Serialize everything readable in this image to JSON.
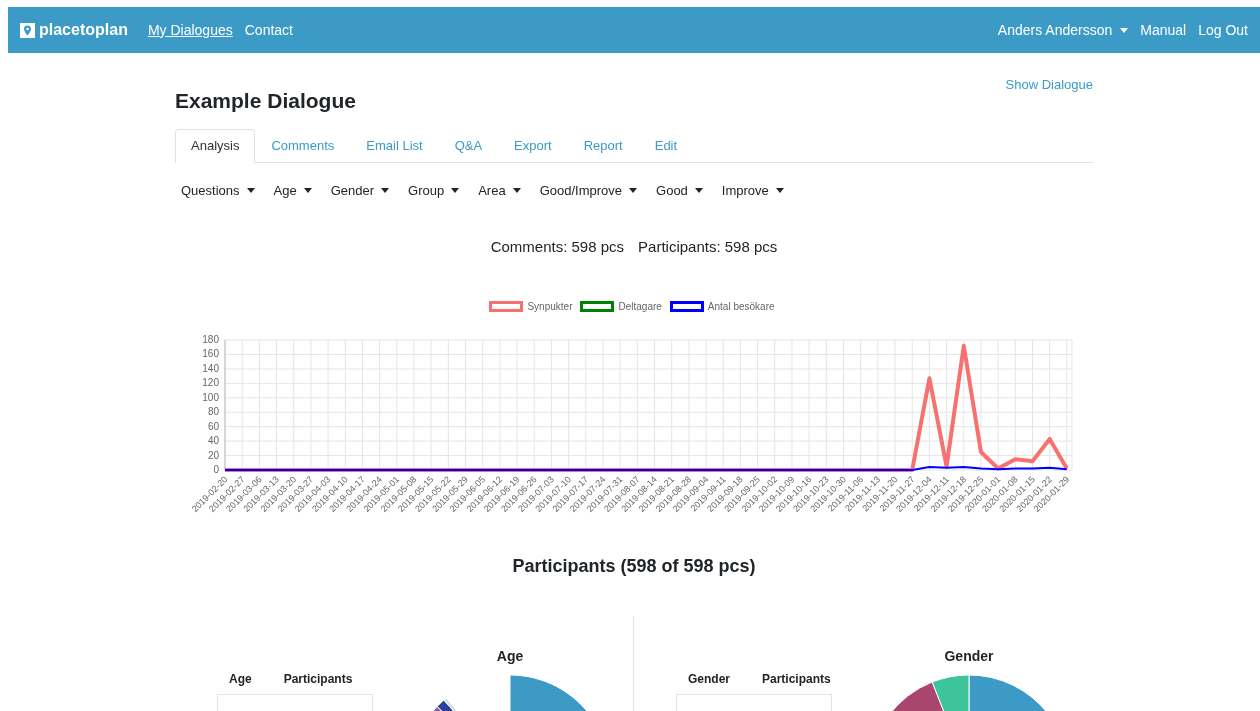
{
  "navbar": {
    "brand": "placetoplan",
    "links": [
      {
        "label": "My Dialogues",
        "selected": true
      },
      {
        "label": "Contact",
        "selected": false
      }
    ],
    "user": "Anders Andersson",
    "right_links": [
      "Manual",
      "Log Out"
    ]
  },
  "page": {
    "title": "Example Dialogue",
    "show_link": "Show Dialogue"
  },
  "tabs": [
    {
      "label": "Analysis",
      "selected": true
    },
    {
      "label": "Comments",
      "selected": false
    },
    {
      "label": "Email List",
      "selected": false
    },
    {
      "label": "Q&A",
      "selected": false
    },
    {
      "label": "Export",
      "selected": false
    },
    {
      "label": "Report",
      "selected": false
    },
    {
      "label": "Edit",
      "selected": false
    }
  ],
  "filters": [
    "Questions",
    "Age",
    "Gender",
    "Group",
    "Area",
    "Good/Improve",
    "Good",
    "Improve"
  ],
  "stats": [
    "Comments: 598 pcs",
    "Participants: 598 pcs"
  ],
  "chart": {
    "chart_data": {
      "type": "line",
      "categories": [
        "2019-02-20",
        "2019-02-27",
        "2019-03-06",
        "2019-03-13",
        "2019-03-20",
        "2019-03-27",
        "2019-04-03",
        "2019-04-10",
        "2019-04-17",
        "2019-04-24",
        "2019-05-01",
        "2019-05-08",
        "2019-05-15",
        "2019-05-22",
        "2019-05-29",
        "2019-06-05",
        "2019-06-12",
        "2019-06-19",
        "2019-06-26",
        "2019-07-03",
        "2019-07-10",
        "2019-07-17",
        "2019-07-24",
        "2019-07-31",
        "2019-08-07",
        "2019-08-14",
        "2019-08-21",
        "2019-08-28",
        "2019-09-04",
        "2019-09-11",
        "2019-09-18",
        "2019-09-25",
        "2019-10-02",
        "2019-10-09",
        "2019-10-16",
        "2019-10-23",
        "2019-10-30",
        "2019-11-06",
        "2019-11-13",
        "2019-11-20",
        "2019-11-27",
        "2019-12-04",
        "2019-12-11",
        "2019-12-18",
        "2019-12-25",
        "2020-01-01",
        "2020-01-08",
        "2020-01-15",
        "2020-01-22",
        "2020-01-29"
      ],
      "series": [
        {
          "name": "Synpukter",
          "color": "#f87171",
          "values": [
            0,
            0,
            0,
            0,
            0,
            0,
            0,
            0,
            0,
            0,
            0,
            0,
            0,
            0,
            0,
            0,
            0,
            0,
            0,
            0,
            0,
            0,
            0,
            0,
            0,
            0,
            0,
            0,
            0,
            0,
            0,
            0,
            0,
            0,
            0,
            0,
            0,
            0,
            0,
            0,
            0,
            127,
            5,
            172,
            25,
            2,
            15,
            12,
            43,
            2
          ]
        },
        {
          "name": "Deltagare",
          "color": "#008000",
          "values": [
            null,
            null,
            null,
            null,
            null,
            null,
            null,
            null,
            null,
            null,
            null,
            null,
            null,
            null,
            null,
            null,
            null,
            null,
            null,
            null,
            null,
            null,
            null,
            null,
            null,
            null,
            null,
            null,
            null,
            null,
            null,
            null,
            null,
            null,
            null,
            null,
            null,
            null,
            null,
            null,
            null,
            null,
            null,
            null,
            null,
            null,
            null,
            null,
            null,
            null
          ]
        },
        {
          "name": "Antal besökare",
          "color": "#0000ff",
          "values": [
            0,
            0,
            0,
            0,
            0,
            0,
            0,
            0,
            0,
            0,
            0,
            0,
            0,
            0,
            0,
            0,
            0,
            0,
            0,
            0,
            0,
            0,
            0,
            0,
            0,
            0,
            0,
            0,
            0,
            0,
            0,
            0,
            0,
            0,
            0,
            0,
            0,
            0,
            0,
            0,
            0,
            4,
            3,
            4,
            2,
            1,
            2,
            2,
            3,
            1
          ]
        }
      ],
      "grid": true,
      "legend": "top",
      "ylim": [
        0,
        180
      ],
      "yticks": [
        0,
        20,
        40,
        60,
        80,
        100,
        120,
        140,
        160,
        180
      ]
    }
  },
  "participants_title": "Participants (598 of 598 pcs)",
  "panels": [
    {
      "title": "Age",
      "columns": [
        "Age",
        "Participants"
      ]
    },
    {
      "title": "Gender",
      "columns": [
        "Gender",
        "Participants"
      ]
    }
  ]
}
